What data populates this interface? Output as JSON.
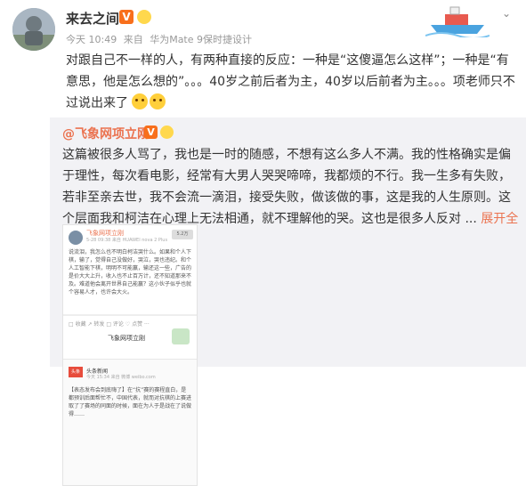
{
  "header": {
    "username": "来去之间",
    "timestamp": "今天 10:49",
    "source_prefix": "来自",
    "source_device": "华为Mate 9保时捷设计"
  },
  "post": {
    "text": "对跟自己不一样的人，有两种直接的反应：一种是“这傻逼怎么这样”；一种是“有意思，他是怎么想的”。。。40岁之前后者为主，40岁以后前者为主。。。项老师只不过说出来了"
  },
  "repost": {
    "author": "@飞象网项立刚",
    "text": "这篇被很多人骂了，我也是一时的随感，不想有这么多人不满。我的性格确实是偏于理性，每次看电影，经常有大男人哭哭啼啼，我都烦的不行。我一生多有失败，若非至亲去世，我不会流一滴泪，接受失败，做该做的事，这是我的人生原则。这个层面我和柯洁在心理上无法相通，就不理解他的哭。这也是很多人反对 ...",
    "expand_label": "展开全文",
    "expand_arrow": "⌄"
  },
  "embed": {
    "top_name": "飞象网项立刚",
    "top_sub": "5-28 09:38 来自 HUAWEI nova 2 Plus",
    "top_pill": "5.2万",
    "top_text": "说流泪，我怎么也不明白柯洁哭什么。如果和个人下棋，输了，觉得自己没做好，哭泣，哭也违纪。和个人工智能下棋，明明不可能赢，输还这一些，广告的是价大大上升，收入也不止百万计，还不知道那来不及。难道他会离开世界自己能赢？这小伙子似乎也就个容易人才，也许会大火。",
    "tool_text": "□ 收藏  ↗ 转发  □ 评论  ♡ 点赞  ···",
    "footer_name": "飞象网项立刚",
    "lower_logo": "头条",
    "lower_name": "头条新闻",
    "lower_sub": "今天 15:34 来自 微博 weibo.com",
    "lower_text": "【表态发布会到底嗨了】在“抗”赛的赛程直白，是都预训后面帮忙不，中国代表，就而对抗棋的上赛进取了了赛场的同面的时候，面在为人于是战在了说做得……"
  },
  "colors": {
    "accent": "#eb7350",
    "text": "#333333",
    "muted": "#999999",
    "repost_bg": "#f2f2f5"
  },
  "icons": {
    "vip": "vip-crown-badge",
    "emoji": "emoji-badge",
    "chevron": "chevron-down-icon",
    "ship": "ship-decoration",
    "face": "grimace-face-emoji"
  }
}
